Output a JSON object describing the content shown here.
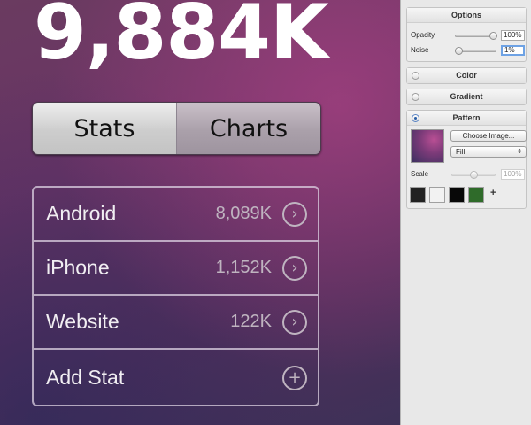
{
  "stats_screen": {
    "total": "9,884K",
    "segments": [
      {
        "label": "Stats",
        "selected": true
      },
      {
        "label": "Charts",
        "selected": false
      }
    ],
    "rows": [
      {
        "label": "Android",
        "value": "8,089K",
        "icon": "chevron-right-icon"
      },
      {
        "label": "iPhone",
        "value": "1,152K",
        "icon": "chevron-right-icon"
      },
      {
        "label": "Website",
        "value": "122K",
        "icon": "chevron-right-icon"
      },
      {
        "label": "Add Stat",
        "value": "",
        "icon": "plus-icon"
      }
    ],
    "colors": {
      "background": "#6b3466",
      "text": "#ffffff"
    }
  },
  "inspector": {
    "options": {
      "title": "Options",
      "opacity_label": "Opacity",
      "opacity_value": "100%",
      "opacity_level": 1.0,
      "noise_label": "Noise",
      "noise_value": "1%",
      "noise_level": 0.01
    },
    "color": {
      "title": "Color",
      "selected": false
    },
    "gradient": {
      "title": "Gradient",
      "selected": false
    },
    "pattern": {
      "title": "Pattern",
      "selected": true,
      "choose_button": "Choose Image...",
      "fill_mode": "Fill",
      "scale_label": "Scale",
      "scale_value": "100%",
      "swatches": [
        "#222222",
        "#f2f2f2",
        "#080808",
        "#2f6b2a"
      ],
      "add_label": "+"
    }
  }
}
